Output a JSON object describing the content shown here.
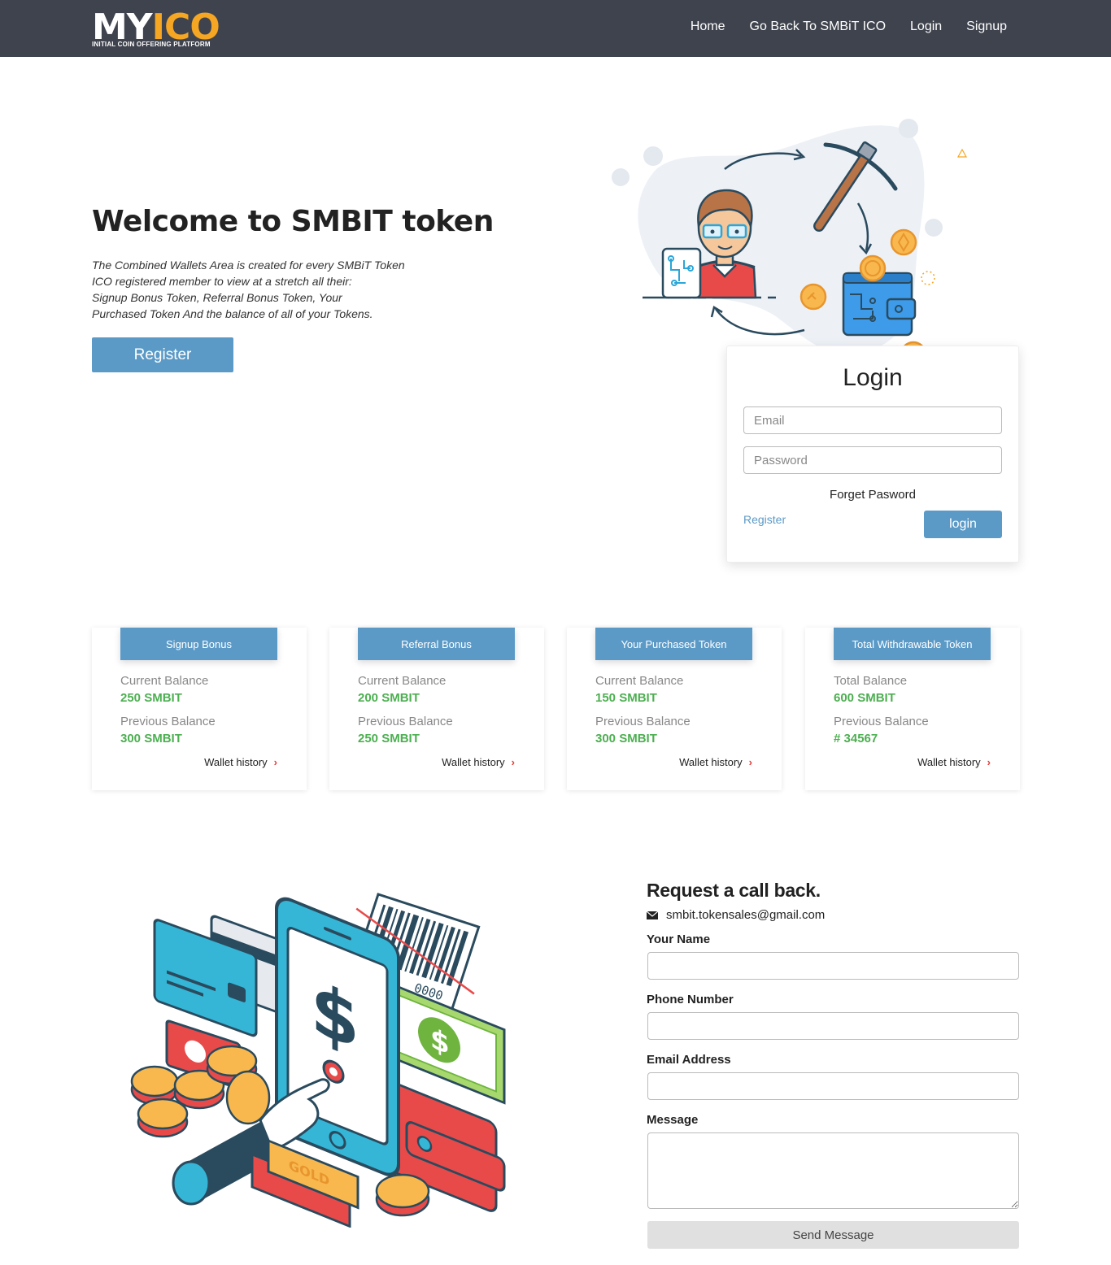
{
  "brand": {
    "logo_my": "MY",
    "logo_ico": "ICO",
    "tagline": "INITIAL COIN OFFERING PLATFORM",
    "accent": "#f5a623",
    "nav_bg": "#3f434d",
    "button_blue": "#5b9ac7",
    "value_green": "#4caf50"
  },
  "nav": {
    "items": [
      "Home",
      "Go Back To SMBiT ICO",
      "Login",
      "Signup"
    ]
  },
  "hero": {
    "title": "Welcome to SMBIT token",
    "desc_lines": [
      "The Combined Wallets Area is created for every SMBiT Token",
      "ICO registered member to view at a stretch all their:",
      "Signup Bonus Token, Referral Bonus Token, Your",
      "Purchased Token And the balance of all of your Tokens."
    ],
    "register_label": "Register"
  },
  "login": {
    "title": "Login",
    "email_placeholder": "Email",
    "password_placeholder": "Password",
    "forget_label": "Forget Pasword",
    "register_link": "Register",
    "login_button": "login"
  },
  "cards": [
    {
      "tab": "Signup Bonus",
      "label1": "Current Balance",
      "value1": "250 SMBIT",
      "label2": "Previous Balance",
      "value2": "300 SMBIT",
      "link": "Wallet history"
    },
    {
      "tab": "Referral Bonus",
      "label1": "Current Balance",
      "value1": "200 SMBIT",
      "label2": "Previous Balance",
      "value2": "250 SMBIT",
      "link": "Wallet history"
    },
    {
      "tab": "Your Purchased Token",
      "label1": "Current Balance",
      "value1": "150 SMBIT",
      "label2": "Previous Balance",
      "value2": "300 SMBIT",
      "link": "Wallet history"
    },
    {
      "tab": "Total Withdrawable Token",
      "label1": "Total Balance",
      "value1": "600 SMBIT",
      "label2": "Previous Balance",
      "value2": "# 34567",
      "link": "Wallet history"
    }
  ],
  "callback": {
    "title": "Request a call back.",
    "email": "smbit.tokensales@gmail.com",
    "name_label": "Your Name",
    "phone_label": "Phone Number",
    "email_label": "Email Address",
    "message_label": "Message",
    "send_label": "Send Message"
  },
  "illustrations": {
    "hero_icon": "crypto-mining-illustration",
    "bottom_icon": "mobile-payment-illustration",
    "gold_bar_text": "GOLD",
    "barcode_text": "0000"
  }
}
